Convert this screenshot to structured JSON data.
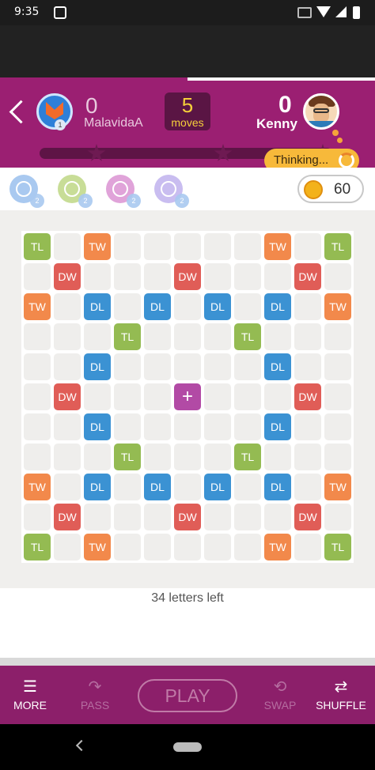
{
  "status_bar": {
    "time": "9:35"
  },
  "header": {
    "player_left": {
      "score": "0",
      "name": "MalavidaA",
      "level": "1"
    },
    "moves": {
      "count": "5",
      "label": "moves"
    },
    "player_right": {
      "score": "0",
      "name": "Kenny"
    },
    "thinking_label": "Thinking...",
    "colors": {
      "header": "#9b1f72",
      "moves_text": "#f5d03a",
      "thinking": "#f7b93a"
    }
  },
  "powerups": [
    {
      "name": "swap-eyes",
      "color": "#a9c9f0",
      "count": "2"
    },
    {
      "name": "target",
      "color": "#c8dd97",
      "count": "2"
    },
    {
      "name": "bomb",
      "color": "#e0a3d9",
      "count": "2"
    },
    {
      "name": "hint",
      "color": "#c9bdf0",
      "count": "2"
    }
  ],
  "coins": {
    "value": "60"
  },
  "board": {
    "tile_colors": {
      "TL": "#94bb52",
      "TW": "#f2894b",
      "DW": "#e05d57",
      "DL": "#3b92d3",
      "+": "#b24aa5"
    },
    "rows": [
      [
        "TL",
        "",
        "TW",
        "",
        "",
        "",
        "",
        "",
        "TW",
        "",
        "TL"
      ],
      [
        "",
        "DW",
        "",
        "",
        "",
        "DW",
        "",
        "",
        "",
        "DW",
        ""
      ],
      [
        "TW",
        "",
        "DL",
        "",
        "DL",
        "",
        "DL",
        "",
        "DL",
        "",
        "TW"
      ],
      [
        "",
        "",
        "",
        "TL",
        "",
        "",
        "",
        "TL",
        "",
        "",
        ""
      ],
      [
        "",
        "",
        "DL",
        "",
        "",
        "",
        "",
        "",
        "DL",
        "",
        ""
      ],
      [
        "",
        "DW",
        "",
        "",
        "",
        "+",
        "",
        "",
        "",
        "DW",
        ""
      ],
      [
        "",
        "",
        "DL",
        "",
        "",
        "",
        "",
        "",
        "DL",
        "",
        ""
      ],
      [
        "",
        "",
        "",
        "TL",
        "",
        "",
        "",
        "TL",
        "",
        "",
        ""
      ],
      [
        "TW",
        "",
        "DL",
        "",
        "DL",
        "",
        "DL",
        "",
        "DL",
        "",
        "TW"
      ],
      [
        "",
        "DW",
        "",
        "",
        "",
        "DW",
        "",
        "",
        "",
        "DW",
        ""
      ],
      [
        "TL",
        "",
        "TW",
        "",
        "",
        "",
        "",
        "",
        "TW",
        "",
        "TL"
      ]
    ]
  },
  "letters_left": "34 letters left",
  "bottom_bar": {
    "more": "MORE",
    "pass": "PASS",
    "play": "PLAY",
    "swap": "SWAP",
    "shuffle": "SHUFFLE"
  }
}
